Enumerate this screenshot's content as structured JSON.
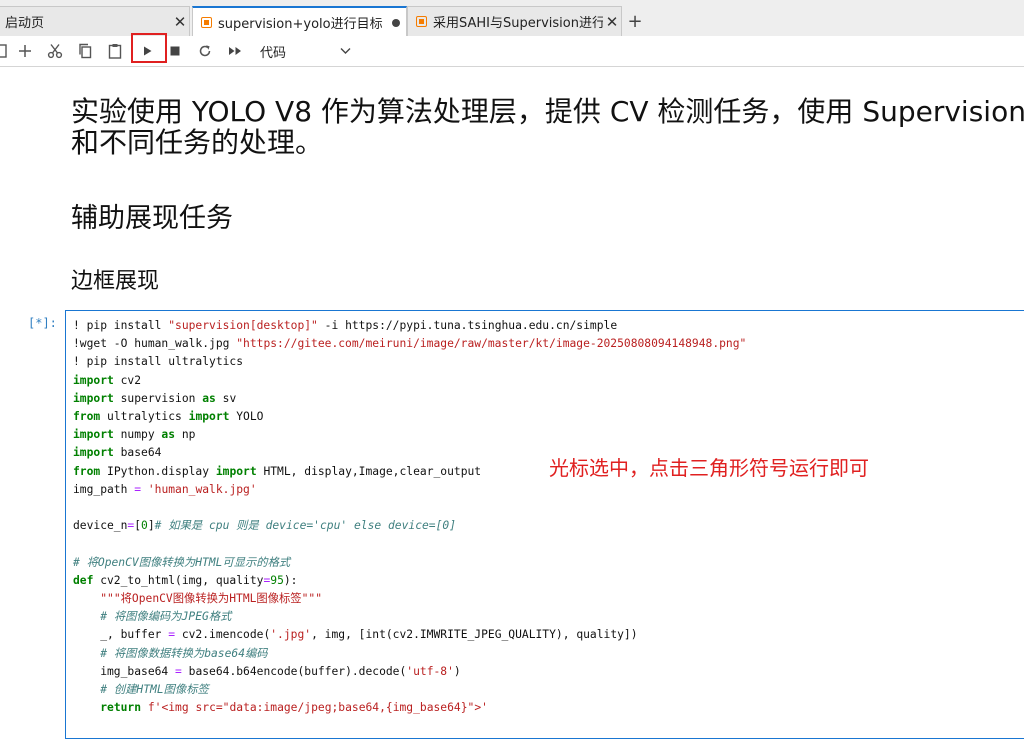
{
  "tabs": [
    {
      "label": "启动页",
      "active": false
    },
    {
      "label": "supervision+yolo进行目标",
      "active": true,
      "modified": true
    },
    {
      "label": "采用SAHI与Supervision进行",
      "active": false
    }
  ],
  "toolbar": {
    "cell_type_value": "代码",
    "buttons": [
      "save-icon",
      "plus-icon",
      "scissors-icon",
      "copy-icon",
      "paste-icon",
      "run-triangle-icon",
      "stop-square-icon",
      "restart-icon",
      "fast-forward-icon",
      "chevron-down-icon"
    ]
  },
  "markdown": {
    "heading1_line1": "实验使用 YOLO V8 作为算法处理层，提供 CV 检测任务，使用 Supervision",
    "heading1_line2": "和不同任务的处理。",
    "heading2": "辅助展现任务",
    "heading3": "边框展现"
  },
  "cell": {
    "prompt": "[*]:",
    "code_lines": [
      "! pip install \"supervision[desktop]\" -i https://pypi.tuna.tsinghua.edu.cn/simple",
      "!wget -O human_walk.jpg \"https://gitee.com/meiruni/image/raw/master/kt/image-20250808094148948.png\"",
      "! pip install ultralytics",
      "import cv2",
      "import supervision as sv",
      "from ultralytics import YOLO",
      "import numpy as np",
      "import base64",
      "from IPython.display import HTML, display,Image,clear_output",
      "img_path = 'human_walk.jpg'",
      "",
      "device_n=[0]# 如果是 cpu 则是 device='cpu' else device=[0]",
      "",
      "# 将OpenCV图像转换为HTML可显示的格式",
      "def cv2_to_html(img, quality=95):",
      "    \"\"\"将OpenCV图像转换为HTML图像标签\"\"\"",
      "    # 将图像编码为JPEG格式",
      "    _, buffer = cv2.imencode('.jpg', img, [int(cv2.IMWRITE_JPEG_QUALITY), quality])",
      "    # 将图像数据转换为base64编码",
      "    img_base64 = base64.b64encode(buffer).decode('utf-8')",
      "    # 创建HTML图像标签",
      "    return f'<img src=\"data:image/jpeg;base64,{img_base64}\">'"
    ]
  },
  "annotation": "光标选中，点击三角形符号运行即可",
  "colors": {
    "accent": "#1976d2",
    "highlight": "#e02020",
    "keyword": "#008000",
    "string": "#ba2121",
    "comment": "#408080"
  }
}
